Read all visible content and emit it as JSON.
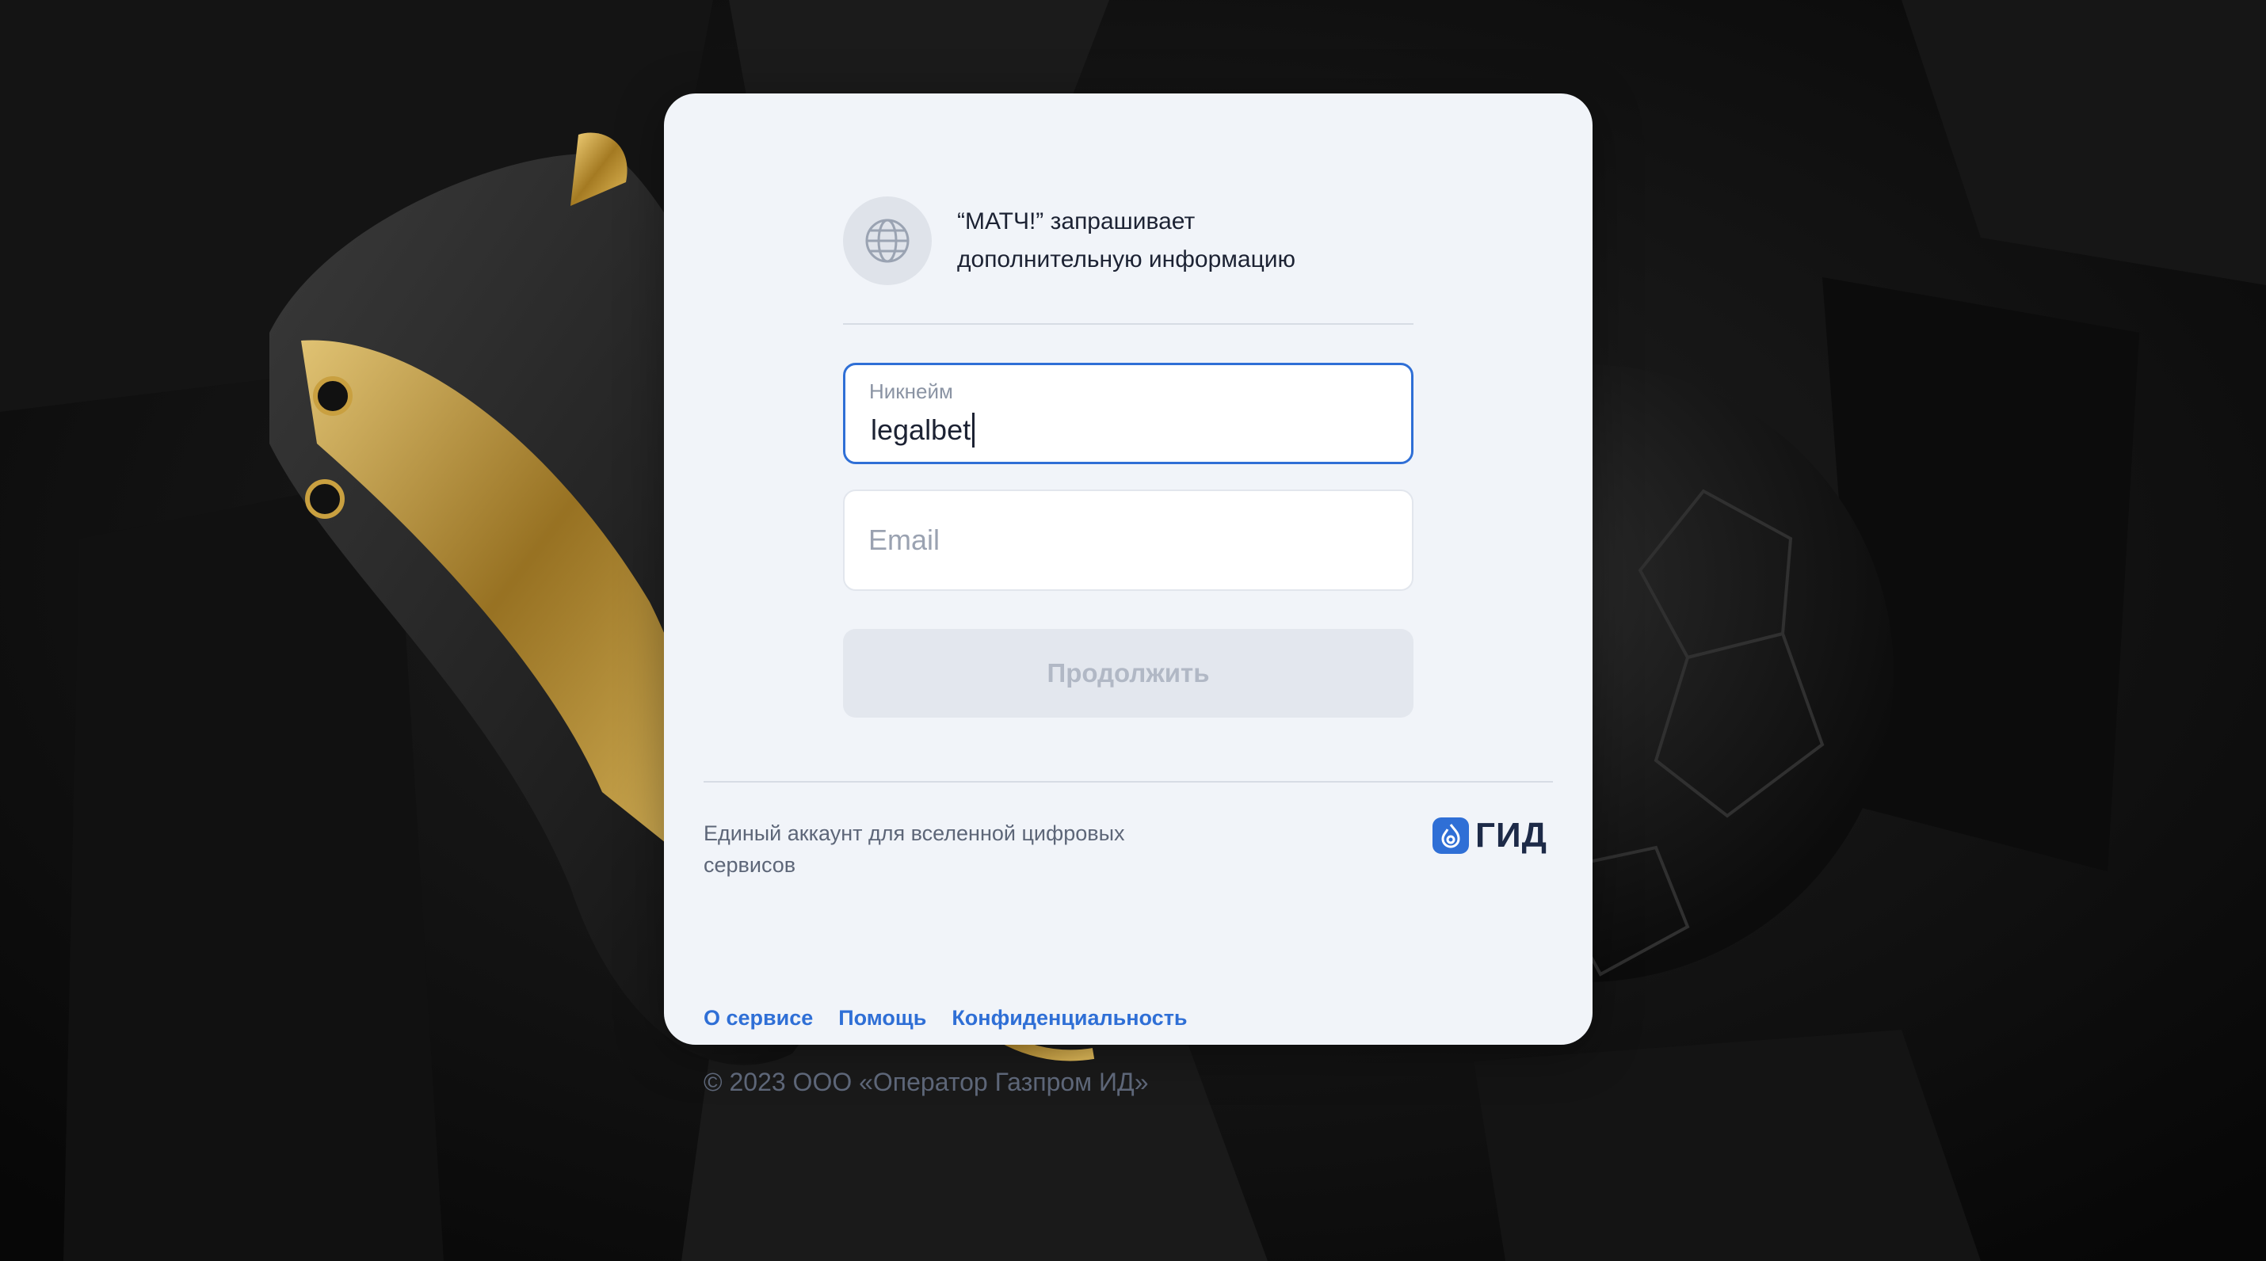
{
  "request": {
    "text_line1": "“МАТЧ!” запрашивает",
    "text_line2": "дополнительную информацию",
    "icon": "globe-icon"
  },
  "form": {
    "nickname": {
      "label": "Никнейм",
      "value": "legalbet"
    },
    "email": {
      "placeholder": "Email",
      "value": ""
    },
    "continue_label": "Продолжить"
  },
  "footer": {
    "tagline": "Единый аккаунт для вселенной цифровых сервисов",
    "logo_text": "ГИД",
    "links": [
      "О сервисе",
      "Помощь",
      "Конфиденциальность"
    ],
    "copyright": "© 2023 ООО «Оператор Газпром ИД»"
  },
  "colors": {
    "accent": "#2f6fd6",
    "card_bg": "#f1f4f9",
    "button_disabled_bg": "#e3e7ee",
    "button_disabled_text": "#b1b8c5"
  }
}
